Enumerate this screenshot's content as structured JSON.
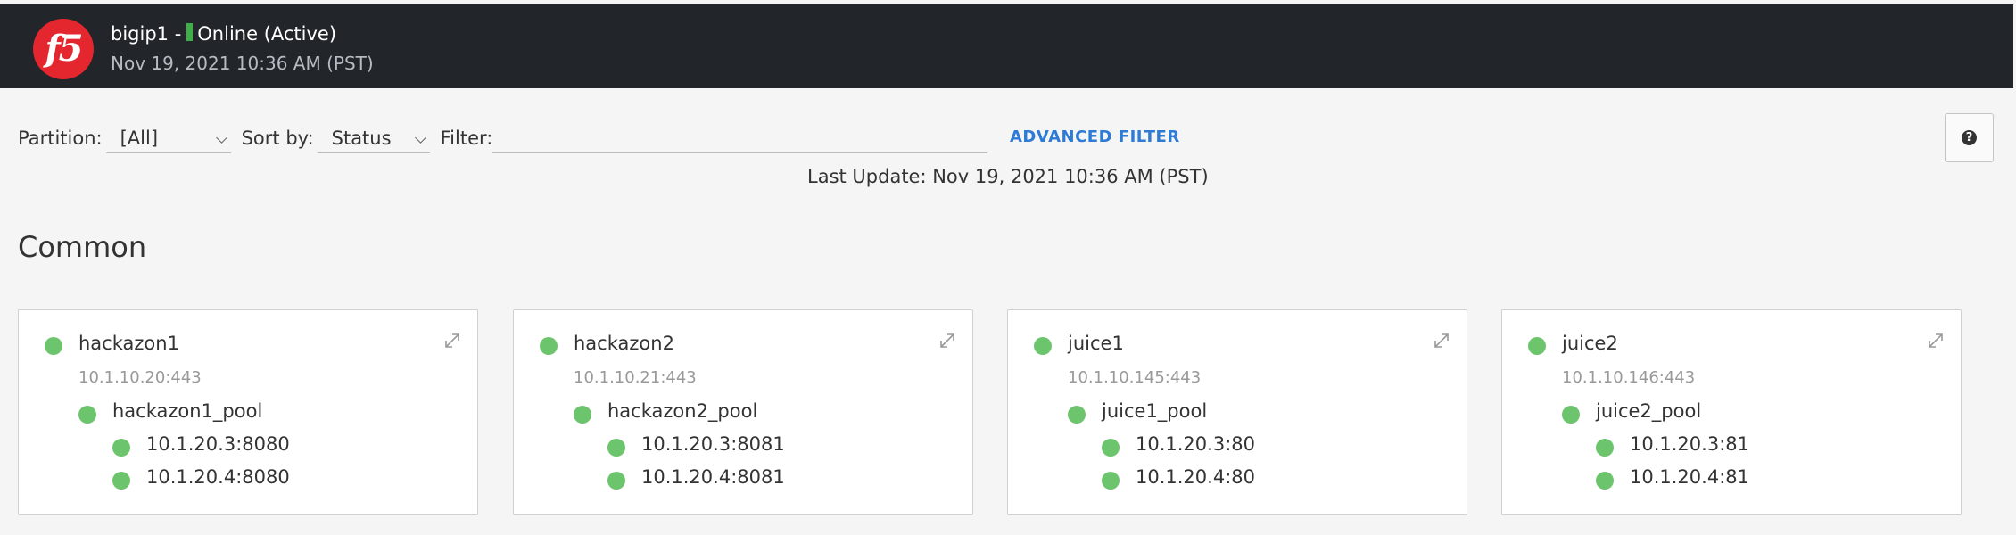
{
  "header": {
    "logo_text": "f5",
    "host_prefix": "bigip1 -",
    "status_text": "Online (Active)",
    "status_color": "#3fae49",
    "datetime": "Nov 19, 2021 10:36 AM (PST)"
  },
  "toolbar": {
    "partition_label": "Partition:",
    "partition_value": "[All]",
    "sort_label": "Sort by:",
    "sort_value": "Status",
    "filter_label": "Filter:",
    "filter_value": "",
    "advanced_filter_label": "ADVANCED FILTER",
    "help_icon": "question-circle-icon"
  },
  "last_update": "Last Update: Nov 19, 2021 10:36 AM (PST)",
  "section_title": "Common",
  "colors": {
    "status_ok": "#6cc56c",
    "accent": "#2d7bd4",
    "brand": "#e4262e"
  },
  "cards": [
    {
      "name": "hackazon1",
      "address": "10.1.10.20:443",
      "pool": "hackazon1_pool",
      "members": [
        "10.1.20.3:8080",
        "10.1.20.4:8080"
      ]
    },
    {
      "name": "hackazon2",
      "address": "10.1.10.21:443",
      "pool": "hackazon2_pool",
      "members": [
        "10.1.20.3:8081",
        "10.1.20.4:8081"
      ]
    },
    {
      "name": "juice1",
      "address": "10.1.10.145:443",
      "pool": "juice1_pool",
      "members": [
        "10.1.20.3:80",
        "10.1.20.4:80"
      ]
    },
    {
      "name": "juice2",
      "address": "10.1.10.146:443",
      "pool": "juice2_pool",
      "members": [
        "10.1.20.3:81",
        "10.1.20.4:81"
      ]
    }
  ]
}
